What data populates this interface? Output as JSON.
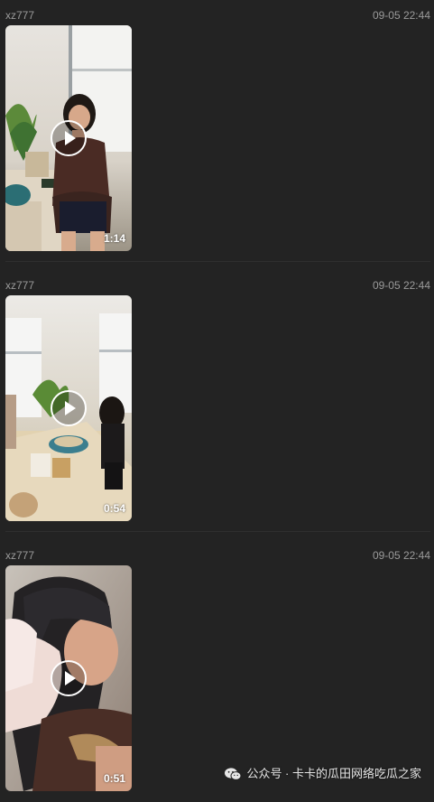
{
  "posts": [
    {
      "sender": "xz777",
      "time": "09-05 22:44",
      "duration": "1:14",
      "play_icon": "play-icon"
    },
    {
      "sender": "xz777",
      "time": "09-05 22:44",
      "duration": "0:54",
      "play_icon": "play-icon"
    },
    {
      "sender": "xz777",
      "time": "09-05 22:44",
      "duration": "0:51",
      "play_icon": "play-icon"
    }
  ],
  "watermark": {
    "icon": "wechat-icon",
    "text": "公众号 · 卡卡的瓜田网络吃瓜之家"
  },
  "colors": {
    "background": "#232323",
    "meta_text": "#9a9a9a",
    "divider": "#2f2f2f",
    "overlay_text": "#ffffff"
  }
}
